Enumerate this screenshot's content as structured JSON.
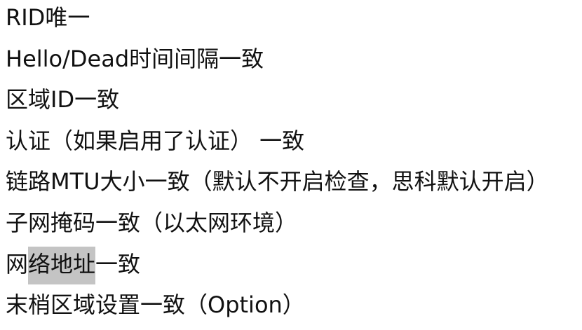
{
  "lines": [
    "RID唯一",
    "Hello/Dead时间间隔一致",
    "区域ID一致",
    "认证（如果启用了认证） 一致",
    "链路MTU大小一致（默认不开启检查，思科默认开启）",
    "子网掩码一致（以太网环境）",
    {
      "before": "网",
      "highlighted": "络地址",
      "after": "一致"
    },
    "末梢区域设置一致（Option）"
  ],
  "highlight_color": "#c4c4c4"
}
